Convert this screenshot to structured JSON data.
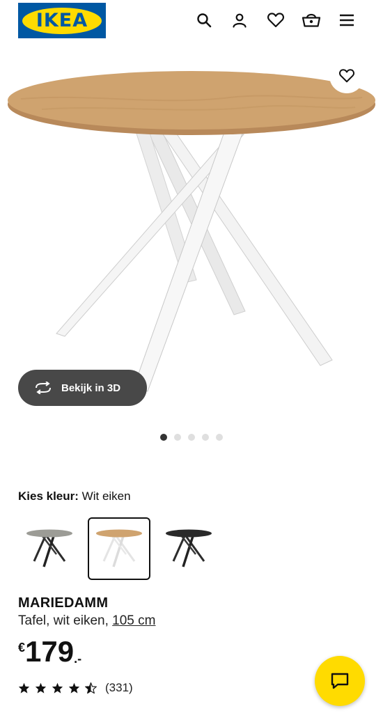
{
  "header": {
    "logo_text": "IKEA",
    "icons": [
      "search-icon",
      "account-icon",
      "favourites-icon",
      "shopping-basket-icon",
      "menu-icon"
    ]
  },
  "gallery": {
    "view_3d_label": "Bekijk in 3D",
    "dot_count": 5,
    "active_dot": 1
  },
  "color_picker": {
    "label": "Kies kleur:",
    "selected_value": "Wit eiken",
    "options": [
      "grey-tabletop-black-legs",
      "oak-tabletop-white-legs",
      "black-tabletop-black-legs"
    ],
    "selected_index": 1
  },
  "product": {
    "name": "MARIEDAMM",
    "description_prefix": "Tafel, wit eiken, ",
    "size": "105 cm",
    "price_currency": "€",
    "price_amount": "179",
    "price_decimal": ".-",
    "rating_stars": 4.5,
    "review_count": "(331)"
  },
  "colors": {
    "brand_blue": "#0058a3",
    "brand_yellow": "#ffdb00",
    "button_dark": "#484848"
  }
}
